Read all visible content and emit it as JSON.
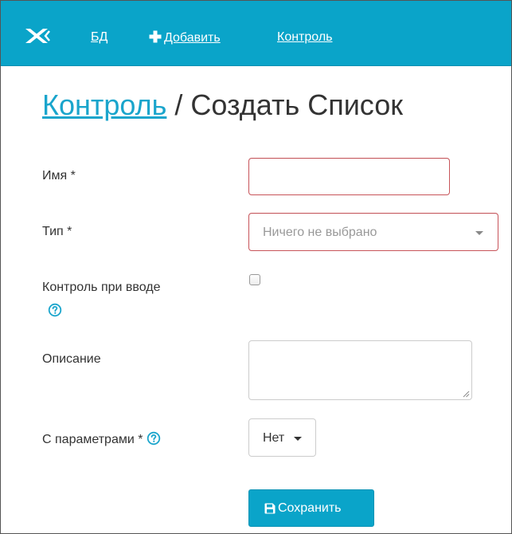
{
  "navbar": {
    "brand_icon": "crossed-swords-logo-icon",
    "links": [
      {
        "label": "БД"
      },
      {
        "label": "Добавить",
        "icon": "plus-icon"
      },
      {
        "label": "Контроль"
      }
    ],
    "background_color": "#0aa4c9"
  },
  "header": {
    "breadcrumb_link": "Контроль",
    "separator": " / ",
    "title": "Создать Список"
  },
  "form": {
    "name": {
      "label": "Имя *",
      "value": ""
    },
    "type": {
      "label": "Тип *",
      "placeholder": "Ничего не выбрано",
      "icon": "caret-down-icon"
    },
    "input_control": {
      "label": "Контроль при вводе",
      "checked": false,
      "help_icon": "question-circle-icon"
    },
    "description": {
      "label": "Описание",
      "value": ""
    },
    "with_params": {
      "label": "С параметрами *",
      "selected": "Нет",
      "help_icon": "question-circle-icon"
    },
    "save_button": {
      "label": "Сохранить",
      "icon": "floppy-disk-icon"
    }
  },
  "colors": {
    "accent": "#0aa4c9",
    "error_border": "#c8545a",
    "link": "#1aa5cc"
  }
}
